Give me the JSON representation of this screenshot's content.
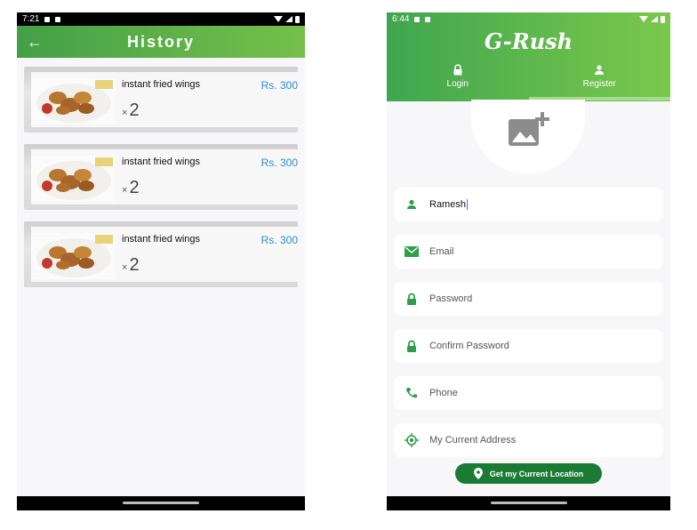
{
  "left": {
    "status_time": "7:21",
    "title": "History",
    "items": [
      {
        "name": "instant fried wings",
        "price": "Rs. 300",
        "qty_prefix": "×",
        "qty": "2"
      },
      {
        "name": "instant fried wings",
        "price": "Rs. 300",
        "qty_prefix": "×",
        "qty": "2"
      },
      {
        "name": "instant fried wings",
        "price": "Rs. 300",
        "qty_prefix": "×",
        "qty": "2"
      }
    ]
  },
  "right": {
    "status_time": "6:44",
    "brand": "G-Rush",
    "tabs": [
      {
        "label": "Login",
        "icon": "lock-icon"
      },
      {
        "label": "Register",
        "icon": "person-icon"
      }
    ],
    "selected_tab": "Register",
    "fields": [
      {
        "icon": "person-icon",
        "value": "Ramesh",
        "placeholder": ""
      },
      {
        "icon": "email-icon",
        "value": "",
        "placeholder": "Email"
      },
      {
        "icon": "lock-icon",
        "value": "",
        "placeholder": "Password"
      },
      {
        "icon": "lock-icon",
        "value": "",
        "placeholder": "Confirm Password"
      },
      {
        "icon": "phone-icon",
        "value": "",
        "placeholder": "Phone"
      },
      {
        "icon": "location-icon",
        "value": "",
        "placeholder": "My Current Address"
      }
    ],
    "location_button": "Get my Current Location"
  },
  "colors": {
    "primary_green": "#43a047",
    "dark_green": "#1b7a34",
    "price_blue": "#2b8fd6"
  }
}
